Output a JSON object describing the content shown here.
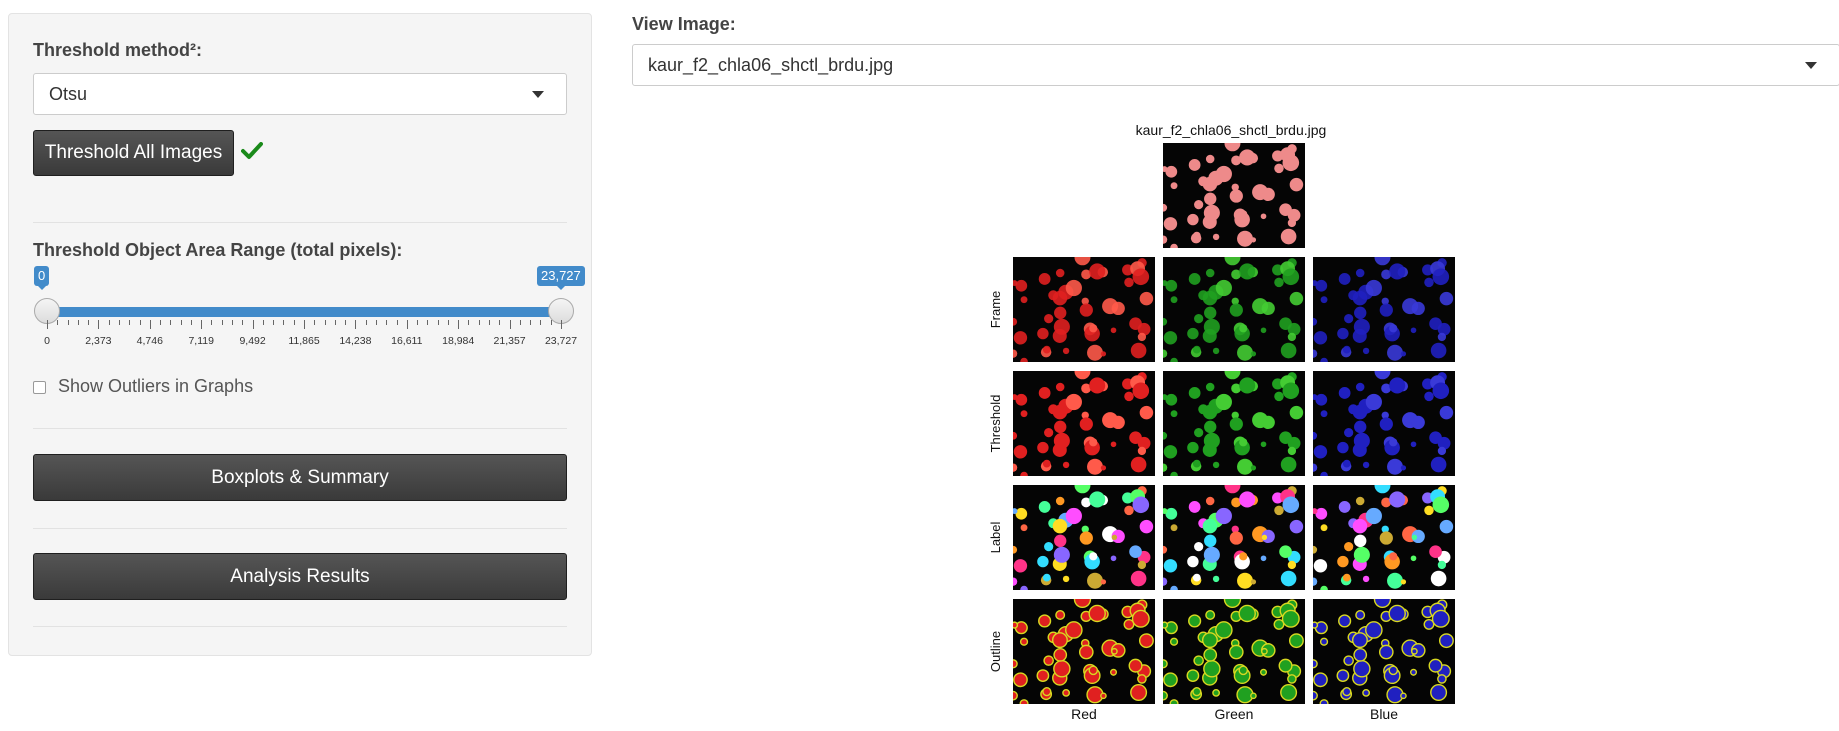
{
  "sidebar": {
    "threshold_method": {
      "label": "Threshold method²:",
      "selected": "Otsu"
    },
    "threshold_all_button": "Threshold All Images",
    "area_range": {
      "label": "Threshold Object Area Range (total pixels):",
      "min_value": "0",
      "max_value": "23,727",
      "range_fraction": [
        0,
        1
      ],
      "ticks": [
        "0",
        "2,373",
        "4,746",
        "7,119",
        "9,492",
        "11,865",
        "14,238",
        "16,611",
        "18,984",
        "21,357",
        "23,727"
      ]
    },
    "show_outliers": {
      "label": "Show Outliers in Graphs",
      "checked": false
    },
    "boxplots_button": "Boxplots & Summary",
    "analysis_button": "Analysis Results"
  },
  "main": {
    "view_image": {
      "label": "View Image:",
      "selected": "kaur_f2_chla06_shctl_brdu.jpg"
    },
    "figure": {
      "title": "kaur_f2_chla06_shctl_brdu.jpg",
      "row_labels": [
        "Frame",
        "Threshold",
        "Label",
        "Outline"
      ],
      "column_labels": [
        "Red",
        "Green",
        "Blue"
      ]
    }
  },
  "colors": {
    "accent": "#428bca",
    "button_dark": "#3a3a3a",
    "check": "#1a8a1a",
    "channel_red": "#e02020",
    "channel_green": "#20a020",
    "channel_blue": "#2020c0"
  },
  "icons": {
    "dropdown": "caret-down-icon",
    "success": "check-icon"
  }
}
